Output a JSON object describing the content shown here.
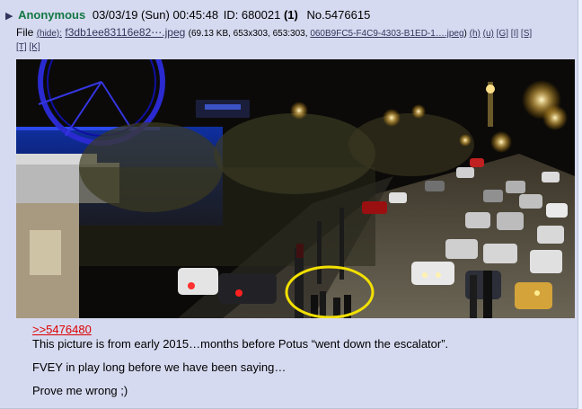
{
  "post": {
    "name": "Anonymous",
    "date": "03/03/19 (Sun) 00:45:48",
    "id_label": "ID: 680021",
    "reply_count": "(1)",
    "number": "No.5476615",
    "file_prefix": "File",
    "hide_label": "(hide):",
    "filename": "f3db1ee83116e82⋯.jpeg",
    "file_meta": "(69.13 KB, 653x303, 653:303,",
    "orig_filename": "060B9FC5-F4C9-4303-B1ED-1….jpeg",
    "file_meta_end": ")",
    "search_links": [
      "(h)",
      "(u)",
      "[G]",
      "[I]",
      "[S]"
    ],
    "search_links_2": [
      "[T]",
      "[K]"
    ],
    "quote_link": ">>5476480",
    "body_lines": [
      "This picture is from early 2015…months before Potus “went down the escalator”.",
      "FVEY in play long before we have been saying…",
      "Prove me wrong ;)"
    ]
  },
  "colors": {
    "name": "#117743",
    "link": "#34345c",
    "quote": "#dd0000",
    "post_bg": "#d6daf0",
    "circle": "#f2e000"
  },
  "image": {
    "description_icon": "night-embankment-photo"
  }
}
